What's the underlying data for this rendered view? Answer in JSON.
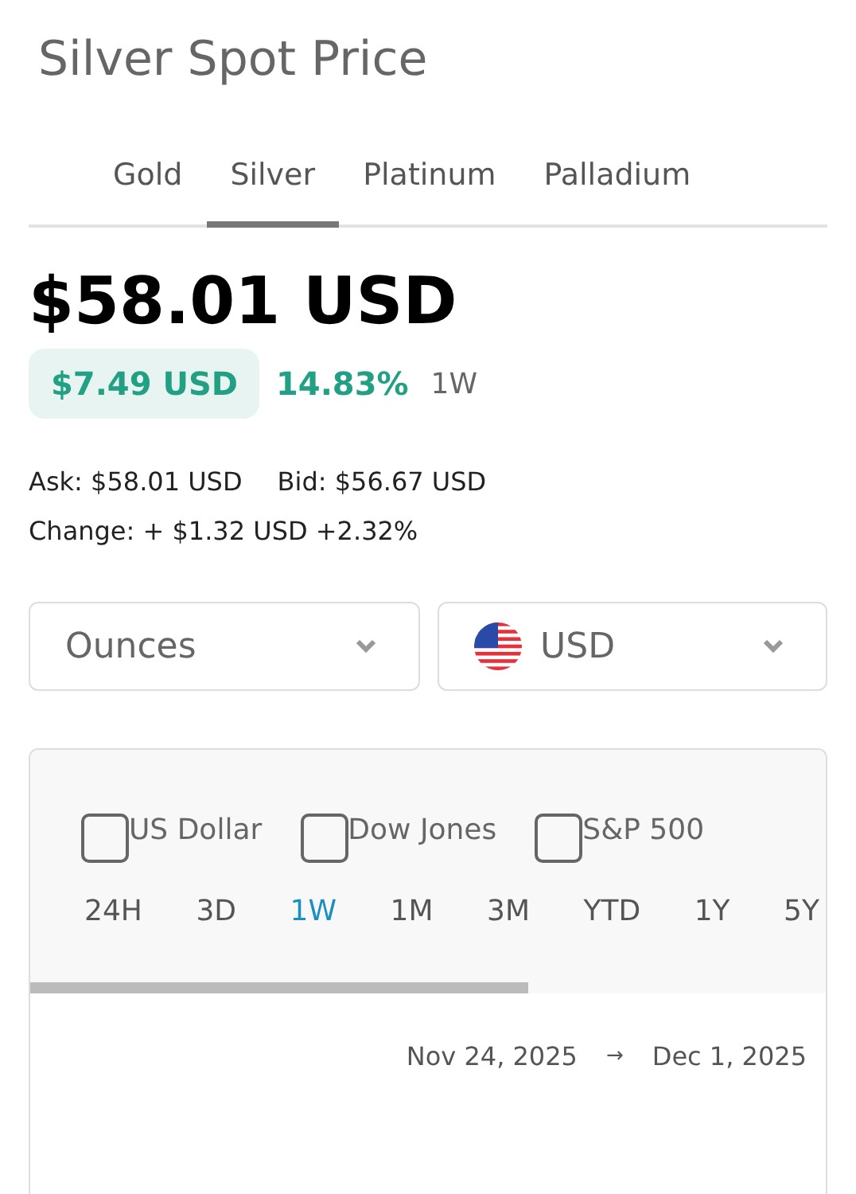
{
  "title": "Silver Spot Price",
  "tabs": [
    {
      "label": "Gold",
      "selected": false
    },
    {
      "label": "Silver",
      "selected": true
    },
    {
      "label": "Platinum",
      "selected": false
    },
    {
      "label": "Palladium",
      "selected": false
    }
  ],
  "price": "$58.01 USD",
  "change": {
    "amount": "$7.49 USD",
    "percent": "14.83%",
    "period": "1W"
  },
  "ask": "Ask: $58.01 USD",
  "bid": "Bid: $56.67 USD",
  "daily_change": "Change: + $1.32 USD +2.32%",
  "unit_select": {
    "value": "Ounces"
  },
  "currency_select": {
    "value": "USD"
  },
  "compare": [
    {
      "label": "US Dollar",
      "checked": false
    },
    {
      "label": "Dow Jones",
      "checked": false
    },
    {
      "label": "S&P 500",
      "checked": false
    }
  ],
  "ranges": [
    {
      "label": "24H",
      "selected": false
    },
    {
      "label": "3D",
      "selected": false
    },
    {
      "label": "1W",
      "selected": true
    },
    {
      "label": "1M",
      "selected": false
    },
    {
      "label": "3M",
      "selected": false
    },
    {
      "label": "YTD",
      "selected": false
    },
    {
      "label": "1Y",
      "selected": false
    },
    {
      "label": "5Y",
      "selected": false
    }
  ],
  "date_range": {
    "start": "Nov 24, 2025",
    "arrow": "→",
    "end": "Dec 1, 2025"
  }
}
